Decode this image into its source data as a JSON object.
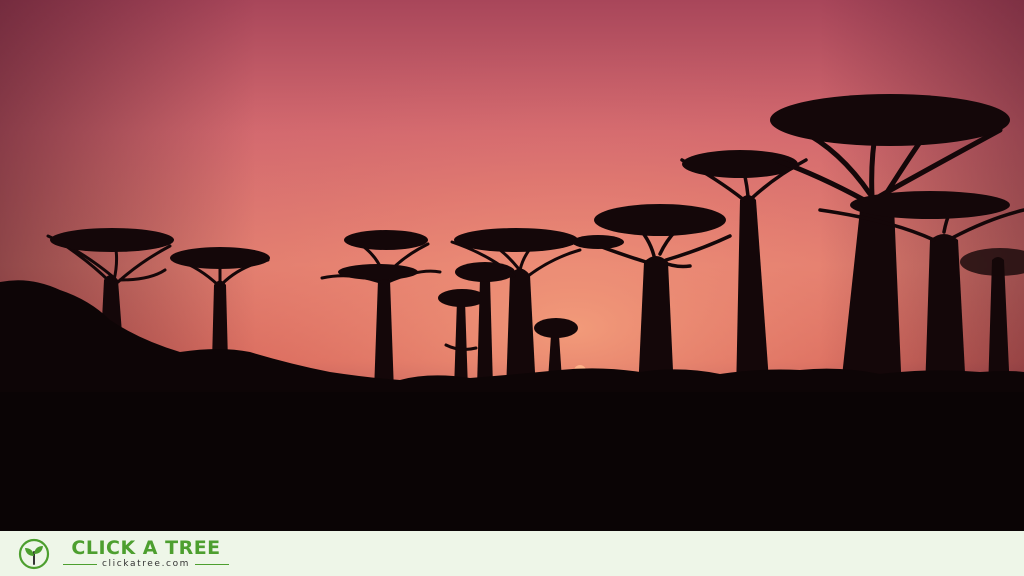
{
  "brand": {
    "name": "CLICK A TREE",
    "url": "clickatree.com",
    "colors": {
      "green": "#4d9f2f",
      "footer_bg": "#eef6e8"
    }
  },
  "photo": {
    "icon": "baobab-sunset-silhouette"
  }
}
